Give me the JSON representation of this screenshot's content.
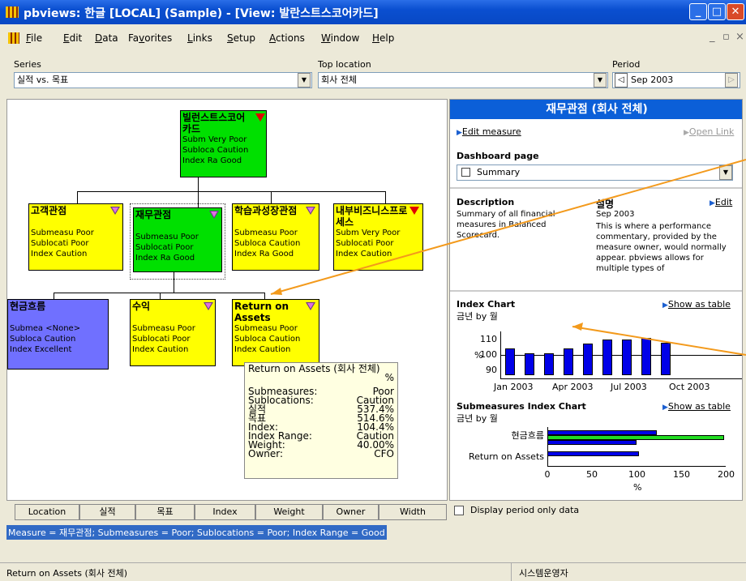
{
  "window": {
    "title": "pbviews: 한글 [LOCAL] (Sample) - [View: 발란스트스코어카드]",
    "min": "_",
    "max": "□",
    "close": "✕"
  },
  "menu": [
    "File",
    "Edit",
    "Data",
    "Favorites",
    "Links",
    "Setup",
    "Actions",
    "Window",
    "Help"
  ],
  "menu_ul": [
    "F",
    "E",
    "D",
    "v",
    "L",
    "S",
    "A",
    "W",
    "H"
  ],
  "mdi_buttons": [
    "_",
    "▫",
    "×"
  ],
  "series": {
    "label": "Series",
    "value": "실적 vs. 목표"
  },
  "top_location": {
    "label": "Top location",
    "value": "회사 전체"
  },
  "period": {
    "label": "Period",
    "value": "Sep 2003",
    "prev": "◁",
    "next": "▷"
  },
  "tree": {
    "root": {
      "title": "빌런스트스코어카드",
      "lines": [
        "Subm Very Poor",
        "Subloca Caution",
        "Index Ra    Good"
      ]
    },
    "n1": {
      "title": "고객관점",
      "lines": [
        "Submeasu  Poor",
        "Sublocati   Poor",
        "Index      Caution"
      ]
    },
    "n2": {
      "title": "재무관점",
      "lines": [
        "Submeasu  Poor",
        "Sublocati   Poor",
        "Index Ra    Good"
      ]
    },
    "n3": {
      "title": "학습과성장관점",
      "lines": [
        "Submeasu  Poor",
        "Subloca Caution",
        "Index Ra    Good"
      ]
    },
    "n4": {
      "title": "내부비즈니스프로세스",
      "lines": [
        "Subm Very Poor",
        "Sublocati   Poor",
        "Index      Caution"
      ]
    },
    "c1": {
      "title": "현금흐름",
      "lines": [
        "Submea  <None>",
        "Subloca Caution",
        "Index   Excellent"
      ]
    },
    "c2": {
      "title": "수익",
      "lines": [
        "Submeasu  Poor",
        "Sublocati   Poor",
        "Index      Caution"
      ]
    },
    "c3": {
      "title": "Return on Assets",
      "lines": [
        "Submeasu  Poor",
        "Subloca Caution",
        "Index      Caution"
      ]
    }
  },
  "tooltip": {
    "title": "Return on Assets (회사 전체)",
    "unit": "%",
    "rows": [
      [
        "Submeasures:",
        "Poor"
      ],
      [
        "Sublocations:",
        "Caution"
      ],
      [
        "실적",
        "537.4%"
      ],
      [
        "목표",
        "514.6%"
      ],
      [
        "Index:",
        "104.4%"
      ],
      [
        "Index Range:",
        "Caution"
      ],
      [
        "Weight:",
        "40.00%"
      ],
      [
        "Owner:",
        "CFO"
      ]
    ]
  },
  "bottom_tabs": [
    "Location",
    "실적",
    "목표",
    "Index",
    "Weight",
    "Owner",
    "Width"
  ],
  "status_message": "Measure = 재무관점; Submeasures = Poor; Sublocations = Poor; Index Range = Good",
  "statusbar": {
    "left": "Return on Assets (회사 전체)",
    "right": "시스템운영자"
  },
  "right": {
    "header": "재무관점 (회사 전체)",
    "edit_measure": "Edit measure",
    "open_link": "Open Link",
    "dashboard_label": "Dashboard page",
    "dashboard_value": "Summary",
    "description_label": "Description",
    "description_text": "Summary of all financial measures in Balanced Scorecard.",
    "comment_label": "설명",
    "edit": "Edit",
    "comment_date": "Sep 2003",
    "comment_text": "This is where a performance commentary, provided by the measure owner, would normally appear. pbviews allows for multiple types of",
    "index_chart_title": "Index Chart",
    "index_chart_sub": "금년 by 월",
    "show_as_table": "Show as table",
    "sub_chart_title": "Submeasures Index Chart",
    "sub_chart_sub": "금년 by 월",
    "display_period_only": "Display period only data"
  },
  "chart_data": [
    {
      "type": "bar",
      "title": "Index Chart",
      "subtitle": "금년 by 월",
      "ylabel": "%",
      "y_ticks": [
        90,
        100,
        110
      ],
      "x_ticks": [
        "Jan 2003",
        "Apr 2003",
        "Jul 2003",
        "Oct 2003"
      ],
      "categories": [
        "Jan 2003",
        "Feb 2003",
        "Mar 2003",
        "Apr 2003",
        "May 2003",
        "Jun 2003",
        "Jul 2003",
        "Aug 2003",
        "Sep 2003"
      ],
      "values": [
        104,
        101,
        101,
        104,
        107,
        110,
        110,
        111,
        108
      ],
      "ylim": [
        85,
        115
      ],
      "reference_line": 100
    },
    {
      "type": "bar",
      "title": "Submeasures Index Chart",
      "subtitle": "금년 by 월",
      "xlabel": "%",
      "x_ticks": [
        0,
        50,
        100,
        150,
        200
      ],
      "xlim": [
        0,
        200
      ],
      "categories": [
        "현금흐름",
        "Return on Assets"
      ],
      "series": [
        {
          "values": [
            123,
            100,
            103
          ]
        },
        {
          "values": [
            198
          ]
        }
      ]
    }
  ]
}
